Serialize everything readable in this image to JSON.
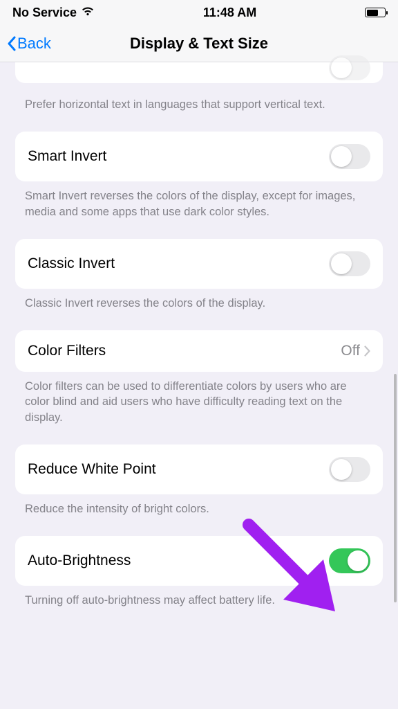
{
  "statusbar": {
    "carrier": "No Service",
    "time": "11:48 AM"
  },
  "navbar": {
    "back_label": "Back",
    "title": "Display & Text Size"
  },
  "partial_toggle": {
    "on": false
  },
  "sections": [
    {
      "id": "prefer_horizontal",
      "footer": "Prefer horizontal text in languages that support vertical text."
    },
    {
      "id": "smart_invert",
      "label": "Smart Invert",
      "toggle": {
        "on": false
      },
      "footer": "Smart Invert reverses the colors of the display, except for images, media and some apps that use dark color styles."
    },
    {
      "id": "classic_invert",
      "label": "Classic Invert",
      "toggle": {
        "on": false
      },
      "footer": "Classic Invert reverses the colors of the display."
    },
    {
      "id": "color_filters",
      "label": "Color Filters",
      "value": "Off",
      "disclosure": true,
      "footer": "Color filters can be used to differentiate colors by users who are color blind and aid users who have difficulty reading text on the display."
    },
    {
      "id": "reduce_white_point",
      "label": "Reduce White Point",
      "toggle": {
        "on": false
      },
      "footer": "Reduce the intensity of bright colors."
    },
    {
      "id": "auto_brightness",
      "label": "Auto-Brightness",
      "toggle": {
        "on": true
      },
      "footer": "Turning off auto-brightness may affect battery life."
    }
  ],
  "annotation": {
    "arrow_color": "#a020f0"
  }
}
